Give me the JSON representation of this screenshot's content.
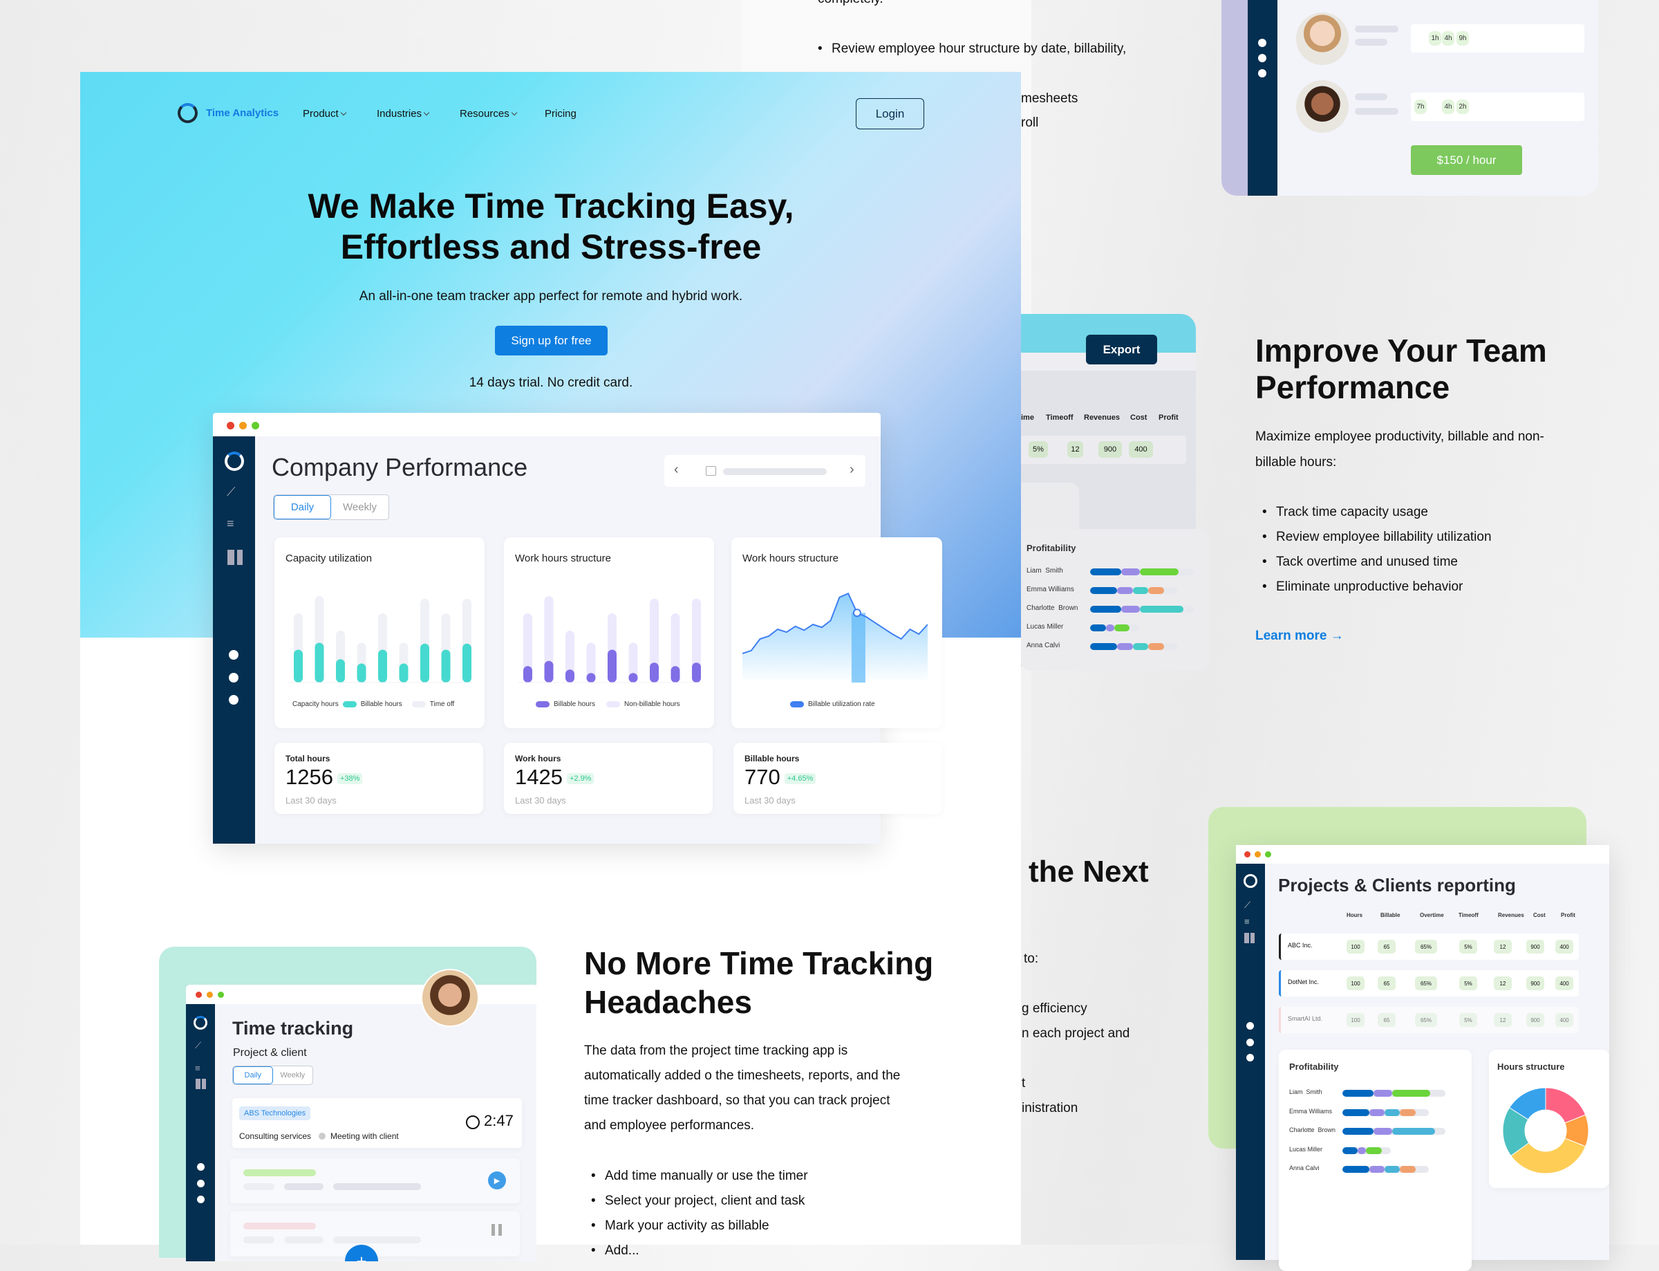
{
  "colors": {
    "navy": "#042f50",
    "primary": "#0e7ee0",
    "green": "#7dc95e",
    "teal": "#46d9cf",
    "purple": "#7f6ee6",
    "light_purple": "#ece9fd"
  },
  "back_page": {
    "top_text": "completely.",
    "bullet": "Review employee hour structure by date, billability,",
    "partial_lines": [
      "mesheets",
      "roll"
    ]
  },
  "nav": {
    "brand": "Time Analytics",
    "items": [
      "Product",
      "Industries",
      "Resources",
      "Pricing"
    ],
    "login": "Login"
  },
  "hero": {
    "title_line1": "We Make Time Tracking Easy,",
    "title_line2": "Effortless and Stress-free",
    "subtitle": "An all-in-one team tracker app perfect for remote and hybrid work.",
    "cta": "Sign up for free",
    "note": "14 days trial. No credit card."
  },
  "dashboard": {
    "title": "Company Performance",
    "tabs": [
      "Daily",
      "Weekly"
    ],
    "active_tab": "Daily",
    "capacity": {
      "title": "Capacity utilization",
      "legend": [
        "Capacity hours",
        "Billable hours",
        "Time off"
      ],
      "capacity_hours": [
        8,
        10,
        6,
        4.6,
        8,
        4.6,
        9.7,
        8,
        9.7
      ],
      "billable_hours": [
        3.8,
        4.6,
        2.7,
        2.2,
        3.8,
        2.2,
        4.5,
        3.8,
        4.5
      ]
    },
    "structure": {
      "title": "Work hours structure",
      "legend": [
        "Billable hours",
        "Non-billable hours"
      ],
      "total_hours": [
        8,
        10,
        6,
        4.6,
        8,
        4.6,
        9.7,
        8,
        9.7
      ],
      "billable_hours": [
        1.9,
        2.5,
        1.5,
        1.1,
        3.8,
        1.1,
        2.3,
        1.9,
        2.3
      ]
    },
    "utilization": {
      "title": "Work hours structure",
      "legend": [
        "Billable utilization rate"
      ],
      "values": [
        30,
        33,
        45,
        48,
        55,
        52,
        58,
        54,
        60,
        57,
        64,
        88,
        92,
        72,
        68,
        62,
        56,
        50,
        45,
        55,
        50,
        60
      ]
    },
    "stats": [
      {
        "label": "Total hours",
        "value": "1256",
        "delta": "+38%",
        "period": "Last 30 days"
      },
      {
        "label": "Work hours",
        "value": "1425",
        "delta": "+2.9%",
        "period": "Last 30 days"
      },
      {
        "label": "Billable hours",
        "value": "770",
        "delta": "+4.65%",
        "period": "Last 30 days"
      }
    ]
  },
  "team_card": {
    "rows": [
      {
        "pills": [
          "1h",
          "4h",
          "9h"
        ]
      },
      {
        "pills": [
          "7h",
          "4h",
          "2h"
        ]
      }
    ],
    "rate": "$150 / hour"
  },
  "export_mock": {
    "button": "Export",
    "headers": [
      "ime",
      "Timeoff",
      "Revenues",
      "Cost",
      "Profit"
    ],
    "row": [
      "%",
      "5%",
      "12",
      "900",
      "400"
    ],
    "profitability": {
      "title": "Profitability",
      "people": [
        {
          "name": "Liam  Smith",
          "segments": [
            0.3,
            0.18,
            0.37,
            0
          ],
          "track": 1.0,
          "type": "green"
        },
        {
          "name": "Emma Williams",
          "segments": [
            0.26,
            0.15,
            0.15,
            0.15
          ],
          "track": 0.84,
          "type": "mix"
        },
        {
          "name": "Charlotte  Brown",
          "segments": [
            0.3,
            0.18,
            0.42,
            0
          ],
          "track": 1.0,
          "type": "teal"
        },
        {
          "name": "Lucas Miller",
          "segments": [
            0.15,
            0.08,
            0.15,
            0
          ],
          "track": 0.47,
          "type": "green"
        },
        {
          "name": "Anna Calvi",
          "segments": [
            0.26,
            0.15,
            0.15,
            0.15
          ],
          "track": 0.84,
          "type": "mix"
        }
      ]
    }
  },
  "improve": {
    "title_line1": "Improve Your Team",
    "title_line2": "Performance",
    "para_line1": "Maximize employee productivity, billable and non-",
    "para_line2": "billable hours:",
    "bullets": [
      "Track time capacity usage",
      "Review employee billability utilization",
      "Tack overtime and unused time",
      "Eliminate unproductive behavior"
    ],
    "link": "Learn more"
  },
  "next_section": {
    "heading": "the Next",
    "lines": [
      "to:",
      "g efficiency",
      "n each project and",
      "t",
      "inistration"
    ]
  },
  "projects": {
    "title": "Projects & Clients reporting",
    "headers": [
      "Hours",
      "Billable",
      "Overtime",
      "Timeoff",
      "Revenues",
      "Cost",
      "Profit"
    ],
    "rows": [
      {
        "name": "ABC Inc.",
        "values": [
          "100",
          "65",
          "65%",
          "5%",
          "12",
          "900",
          "400"
        ],
        "accent": "#222222"
      },
      {
        "name": "DotNet Inc.",
        "values": [
          "100",
          "65",
          "65%",
          "5%",
          "12",
          "900",
          "400"
        ],
        "accent": "#2a8ae6"
      },
      {
        "name": "SmartAI Ltd.",
        "values": [
          "100",
          "65",
          "65%",
          "5%",
          "12",
          "900",
          "400"
        ],
        "accent": "#f6c3c3"
      }
    ],
    "profitability_title": "Profitability",
    "hours_structure": {
      "title": "Hours structure",
      "slices": [
        {
          "value": 19,
          "color": "#fe6283"
        },
        {
          "value": 12,
          "color": "#fe9f40"
        },
        {
          "value": 34,
          "color": "#fecd56"
        },
        {
          "value": 19,
          "color": "#4bc0c0"
        },
        {
          "value": 16,
          "color": "#36a2eb"
        }
      ]
    }
  },
  "time_tracking": {
    "title": "Time tracking",
    "subtitle": "Project & client",
    "tabs": [
      "Daily",
      "Weekly"
    ],
    "entry": {
      "client": "ABS Technologies",
      "service": "Consulting services",
      "task": "Meeting with client",
      "time": "2:47"
    }
  },
  "headaches": {
    "title_line1": "No More Time Tracking",
    "title_line2": "Headaches",
    "para": [
      "The data from the project time tracking app is",
      "automatically added o the timesheets, reports, and the",
      "time tracker dashboard, so that you can track project",
      "and employee performances."
    ],
    "bullets": [
      "Add time manually or use the timer",
      "Select your project, client and task",
      "Mark your activity as billable",
      "Add..."
    ]
  }
}
